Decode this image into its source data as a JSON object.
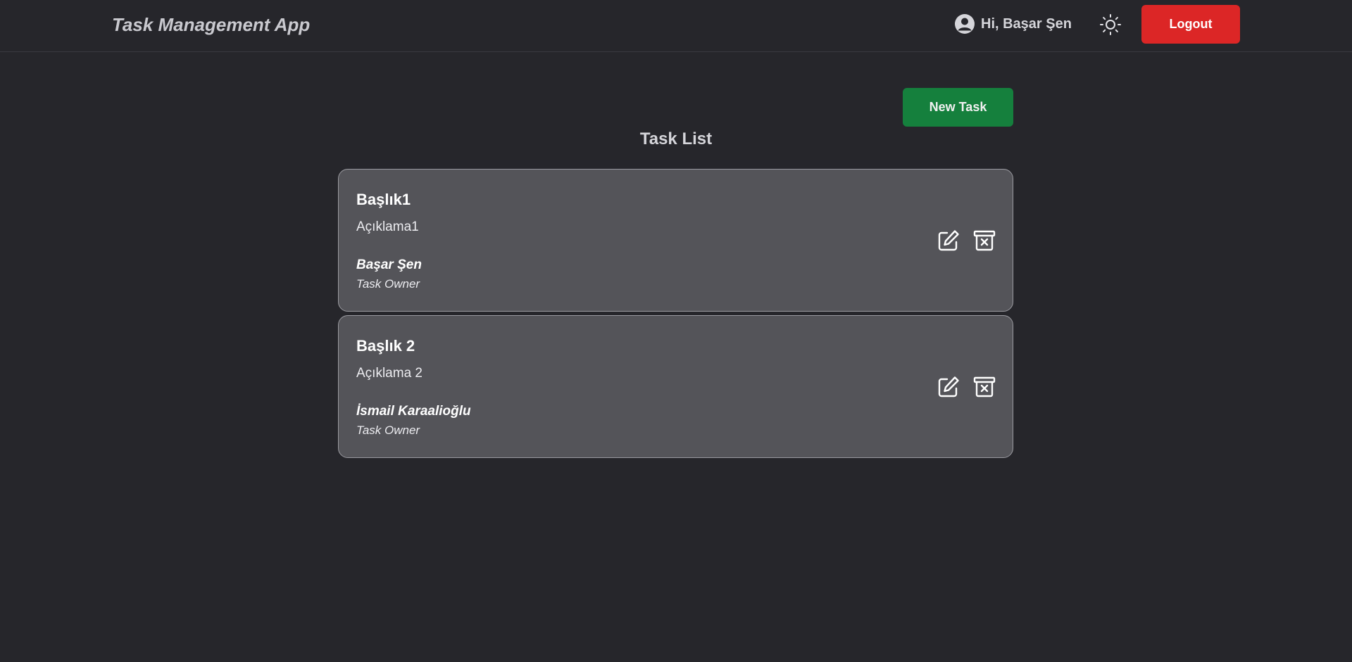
{
  "header": {
    "brand": "Task Management App",
    "greeting": "Hi, Başar Şen",
    "user_icon": "user-circle-icon",
    "theme_icon": "sun-icon",
    "logout_label": "Logout"
  },
  "main": {
    "new_task_label": "New Task",
    "title": "Task List",
    "tasks": [
      {
        "title": "Başlık1",
        "description": "Açıklama1",
        "owner": "Başar Şen",
        "role": "Task Owner"
      },
      {
        "title": "Başlık 2",
        "description": "Açıklama 2",
        "owner": "İsmail Karaalioğlu",
        "role": "Task Owner"
      }
    ],
    "edit_icon": "edit-icon",
    "delete_icon": "archive-x-icon"
  },
  "colors": {
    "background": "#26262b",
    "card": "#545459",
    "logout": "#dc2626",
    "new_task": "#15803d"
  }
}
